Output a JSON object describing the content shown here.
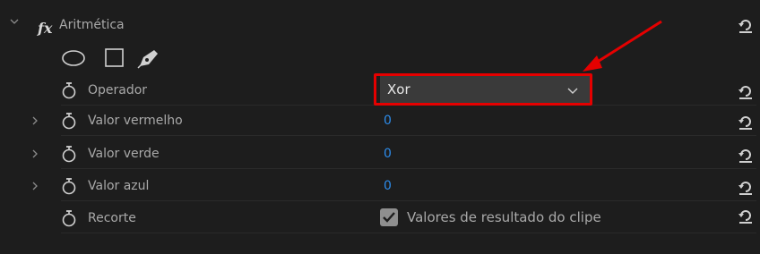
{
  "effect": {
    "title": "Aritmética",
    "fx_symbol": "fx",
    "icons": {
      "collapse": "chevron-down-icon",
      "reset": "reset-icon"
    }
  },
  "mask_tools": [
    "ellipse-mask-icon",
    "rectangle-mask-icon",
    "pen-mask-icon"
  ],
  "properties": {
    "operator": {
      "label": "Operador",
      "value": "Xor"
    },
    "red": {
      "label": "Valor vermelho",
      "value": "0"
    },
    "green": {
      "label": "Valor verde",
      "value": "0"
    },
    "blue": {
      "label": "Valor azul",
      "value": "0"
    },
    "clip": {
      "label": "Recorte",
      "checkbox_label": "Valores de resultado do clipe",
      "checked": true
    }
  },
  "colors": {
    "background": "#1d1d1d",
    "value_blue": "#2d8ceb",
    "annotation_red": "#e50000",
    "dropdown_bg": "#3a3a3a"
  }
}
